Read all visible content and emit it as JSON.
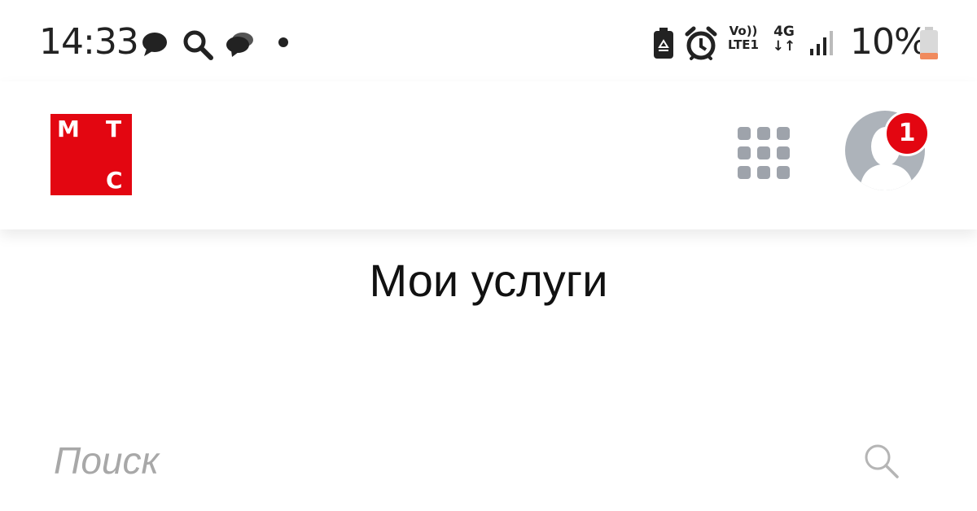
{
  "status_bar": {
    "time": "14:33",
    "battery_percent": "10%",
    "volte_label_top": "Vo))",
    "volte_label_bottom": "LTE1",
    "network_label": "4G",
    "network_arrows": "↓↑",
    "icons": [
      "message-icon",
      "search-icon",
      "chat-icon",
      "dot-icon",
      "battery-saver-icon",
      "alarm-icon",
      "volte-icon",
      "network-4g-icon",
      "signal-icon",
      "battery-icon"
    ]
  },
  "header": {
    "logo": {
      "letters": [
        "М",
        "Т",
        "С"
      ],
      "brand_color": "#e30611"
    },
    "apps_icon": "apps-grid-icon",
    "profile": {
      "icon": "avatar-icon",
      "notification_count": "1"
    }
  },
  "main": {
    "title": "Мои услуги",
    "search": {
      "placeholder": "Поиск",
      "value": "",
      "icon": "search-icon"
    }
  },
  "colors": {
    "accent": "#e30611",
    "icon_gray": "#9ea3ab",
    "text": "#111111",
    "placeholder": "#a8a8a8"
  }
}
